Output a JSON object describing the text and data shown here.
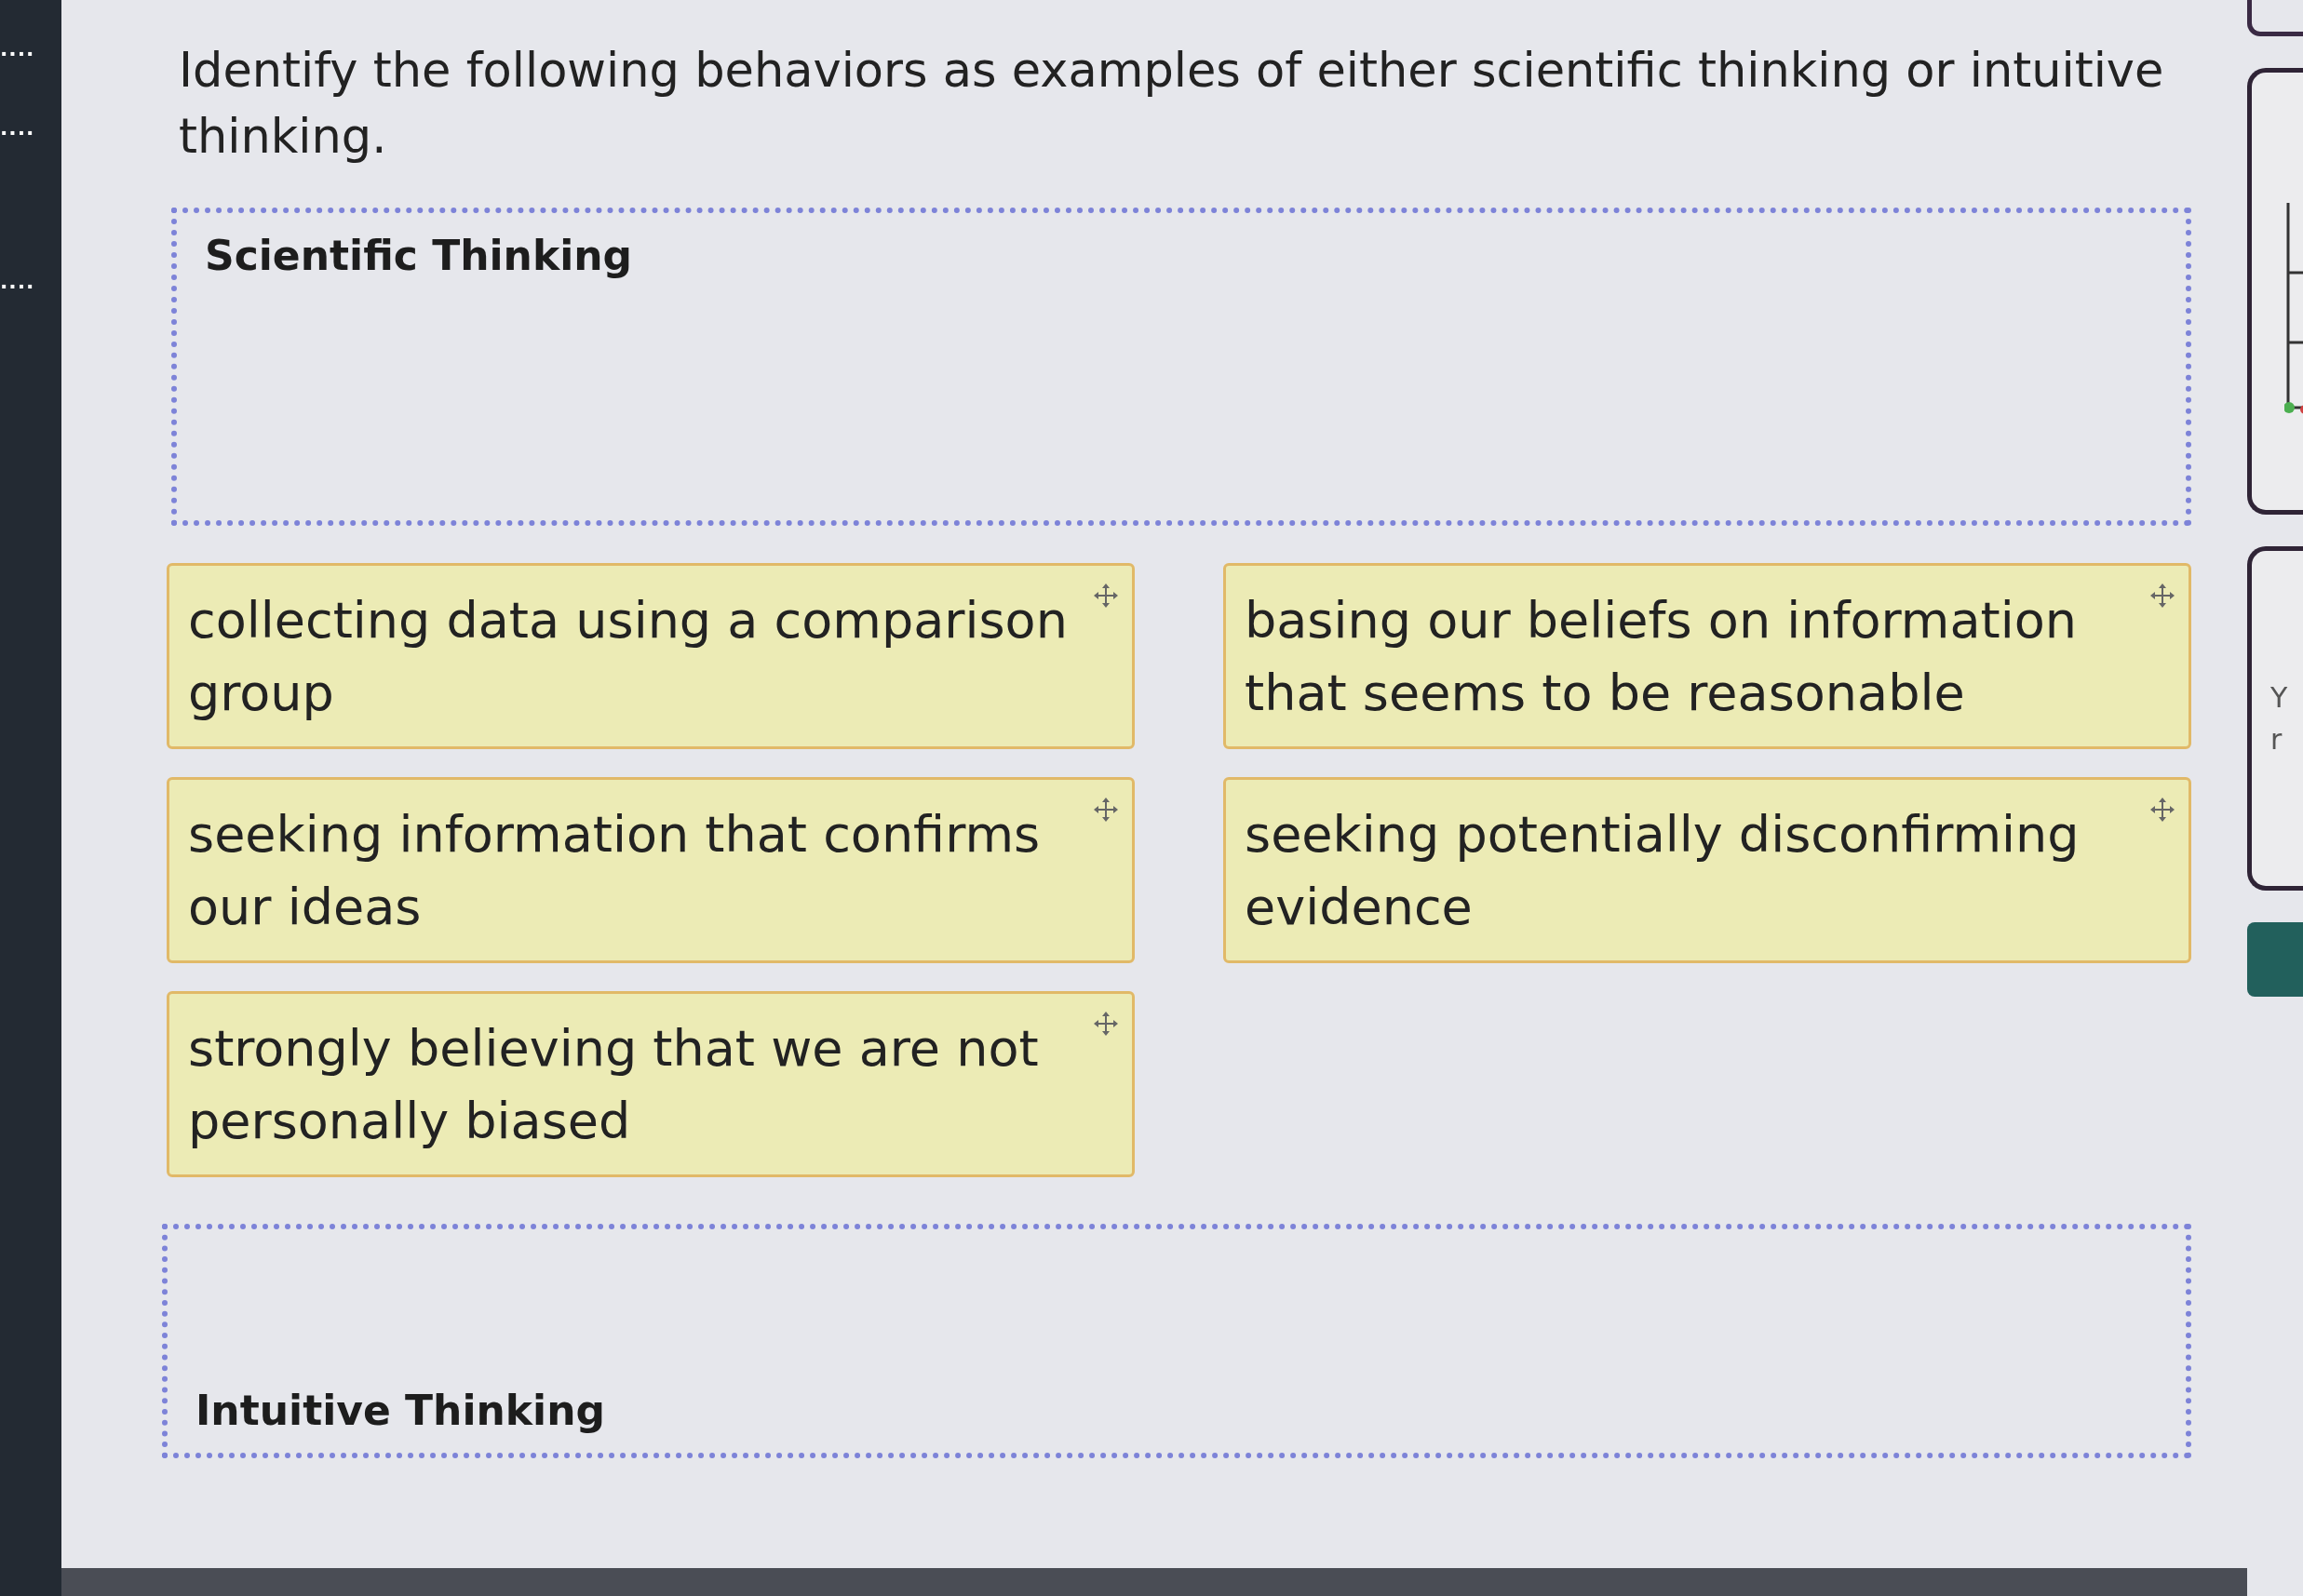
{
  "sidebar": {
    "items": [
      "....",
      "....",
      "...."
    ]
  },
  "question": "Identify the following behaviors as examples of either scientific thinking or intuitive thinking.",
  "zones": [
    {
      "label": "Scientific Thinking"
    }
  ],
  "cards": [
    {
      "text": "collecting data using a comparison group"
    },
    {
      "text": "basing our beliefs on information that seems to be reasonable"
    },
    {
      "text": "seeking information that confirms our ideas"
    },
    {
      "text": "seeking potentially disconfirming evidence"
    },
    {
      "text": "strongly believing that we are not personally biased"
    }
  ],
  "bottom_zones": [
    {
      "label": "Intuitive Thinking"
    }
  ],
  "right_panel": {
    "lines": [
      "Y",
      "r"
    ]
  }
}
